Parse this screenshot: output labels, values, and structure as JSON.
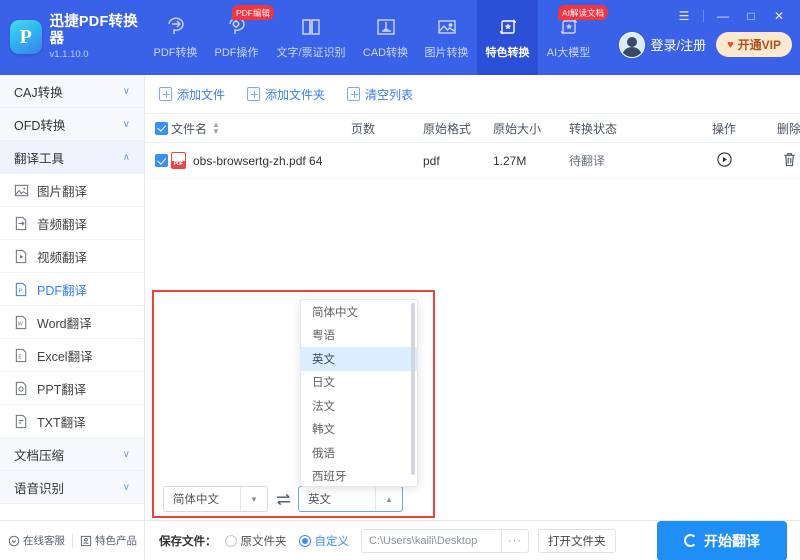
{
  "app": {
    "brand_name": "迅捷PDF转换器",
    "version": "v1.1.10.0",
    "logo_letter": "P"
  },
  "header": {
    "nav": [
      {
        "label": "PDF转换",
        "icon": "pdf-convert-icon",
        "badge": "",
        "active": false
      },
      {
        "label": "PDF操作",
        "icon": "pdf-operate-icon",
        "badge": "PDF编辑",
        "active": false
      },
      {
        "label": "文字/票证识别",
        "icon": "ocr-icon",
        "badge": "",
        "active": false
      },
      {
        "label": "CAD转换",
        "icon": "cad-convert-icon",
        "badge": "",
        "active": false
      },
      {
        "label": "图片转换",
        "icon": "image-convert-icon",
        "badge": "",
        "active": false
      },
      {
        "label": "特色转换",
        "icon": "feature-convert-icon",
        "badge": "",
        "active": true
      },
      {
        "label": "AI大模型",
        "icon": "ai-model-icon",
        "badge": "AI解读文档",
        "active": false
      }
    ],
    "login_label": "登录/注册",
    "vip_label": "开通VIP",
    "window": {
      "menu": "☰",
      "minimize": "—",
      "maximize": "□",
      "close": "✕"
    }
  },
  "sidebar": {
    "groups": [
      {
        "label": "CAJ转换",
        "expanded": false,
        "chevron": "∨"
      },
      {
        "label": "OFD转换",
        "expanded": false,
        "chevron": "∨"
      },
      {
        "label": "翻译工具",
        "expanded": true,
        "chevron": "∧"
      }
    ],
    "items": [
      {
        "label": "图片翻译",
        "icon": "image-translate-icon",
        "active": false
      },
      {
        "label": "音频翻译",
        "icon": "audio-translate-icon",
        "active": false
      },
      {
        "label": "视频翻译",
        "icon": "video-translate-icon",
        "active": false
      },
      {
        "label": "PDF翻译",
        "icon": "pdf-translate-icon",
        "active": true
      },
      {
        "label": "Word翻译",
        "icon": "word-translate-icon",
        "active": false
      },
      {
        "label": "Excel翻译",
        "icon": "excel-translate-icon",
        "active": false
      },
      {
        "label": "PPT翻译",
        "icon": "ppt-translate-icon",
        "active": false
      },
      {
        "label": "TXT翻译",
        "icon": "txt-translate-icon",
        "active": false
      }
    ],
    "groups_bottom": [
      {
        "label": "文档压缩",
        "chevron": "∨"
      },
      {
        "label": "语音识别",
        "chevron": "∨"
      }
    ],
    "status": {
      "service_label": "在线客服",
      "products_label": "特色产品"
    }
  },
  "toolbar": {
    "add_file": "添加文件",
    "add_folder": "添加文件夹",
    "clear_list": "清空列表"
  },
  "table": {
    "columns": [
      "文件名",
      "页数",
      "原始格式",
      "原始大小",
      "转换状态",
      "操作",
      "删除"
    ],
    "rows": [
      {
        "checked": true,
        "file_icon": "pdf-file-icon",
        "file_badge": "PDF",
        "name": "obs-browsertg-zh.pdf 64",
        "pages": "",
        "format": "pdf",
        "size": "1.27M",
        "status": "待翻译",
        "action_icon": "play-circle-icon",
        "delete_icon": "trash-icon"
      }
    ]
  },
  "language_panel": {
    "source": {
      "value": "简体中文",
      "arrow": "▼"
    },
    "swap_icon": "swap-horizontal-icon",
    "target": {
      "value": "英文",
      "arrow": "▲"
    },
    "dropdown": {
      "options": [
        "简体中文",
        "粤语",
        "英文",
        "日文",
        "法文",
        "韩文",
        "俄语",
        "西班牙"
      ],
      "selected": "英文"
    },
    "highlight_color": "#f0403a"
  },
  "footer": {
    "save_label": "保存文件：",
    "option_original": "原文件夹",
    "option_custom": "自定义",
    "selected_option": "自定义",
    "path_value": "C:\\Users\\kaili\\Desktop",
    "browse_label": "···",
    "open_folder_label": "打开文件夹",
    "start_label": "开始翻译"
  },
  "colors": {
    "brand_blue": "#3a62e8",
    "active_nav": "#2b4fd6",
    "accent_blue": "#3a7ef0",
    "start_button": "#1f8ff5",
    "highlight_red": "#f0403a"
  }
}
